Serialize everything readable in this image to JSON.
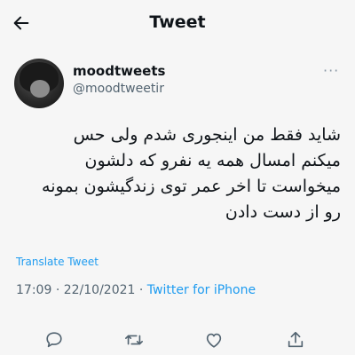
{
  "header": {
    "title": "Tweet"
  },
  "author": {
    "display_name": "moodtweets",
    "username": "@moodtweetir"
  },
  "tweet": {
    "lines": [
      "شاید فقط من اینجوری شدم ولی حس",
      "میکنم امسال همه یه نفرو که دلشون",
      "میخواست تا اخر عمر توی زندگیشون بمونه",
      "رو از دست دادن"
    ]
  },
  "translate_label": "Translate Tweet",
  "meta": {
    "time": "17:09",
    "date": "22/10/2021",
    "separator": "·",
    "source": "Twitter for iPhone"
  },
  "more_label": "···",
  "icons": [
    "back-arrow-icon",
    "more-icon",
    "reply-icon",
    "retweet-icon",
    "like-icon",
    "share-icon"
  ],
  "colors": {
    "link": "#1d9bf0",
    "text": "#0f1419",
    "secondary": "#536471",
    "background": "#f6f6f6"
  }
}
